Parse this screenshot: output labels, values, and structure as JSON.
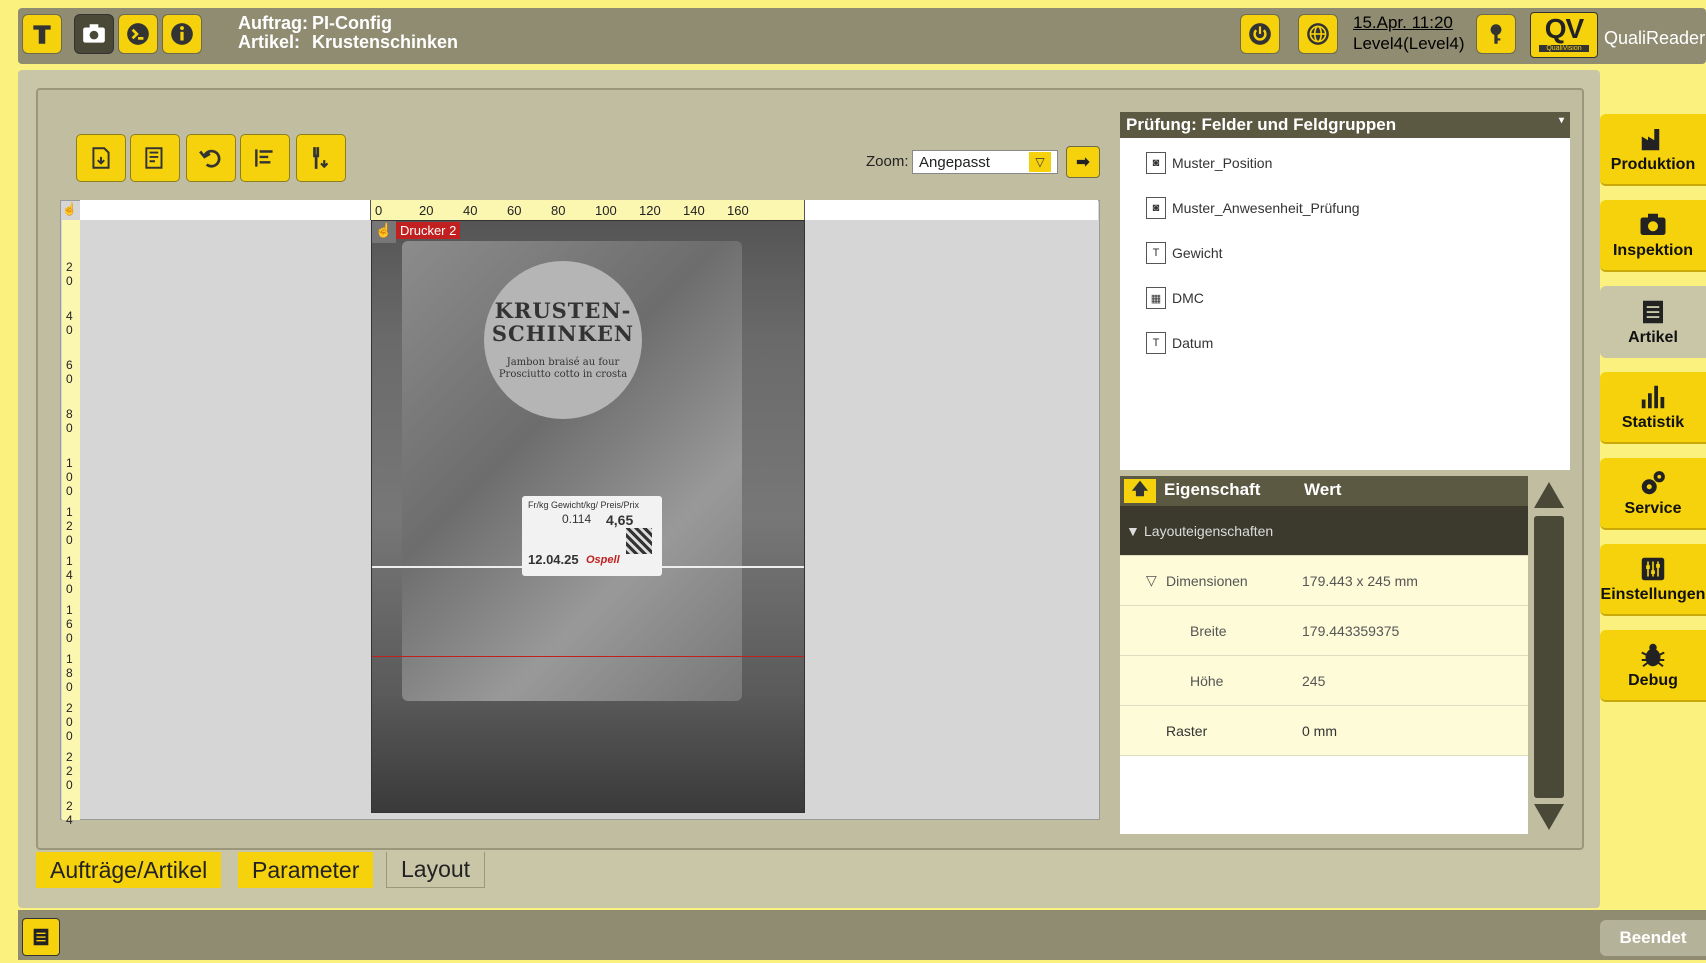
{
  "header": {
    "auftrag_label": "Auftrag:",
    "auftrag_value": "PI-Config",
    "artikel_label": "Artikel:",
    "artikel_value": "Krustenschinken",
    "datetime": "15.Apr. 11:20",
    "level": "Level4(Level4)",
    "logo_text": "QV",
    "logo_sub": "QualiVision",
    "brand": "QualiReader"
  },
  "toolbar": {
    "zoom_label": "Zoom:",
    "zoom_value": "Angepasst"
  },
  "ruler": {
    "h_ticks": [
      "0",
      "20",
      "40",
      "60",
      "80",
      "100",
      "120",
      "140",
      "160"
    ],
    "v_ticks": [
      "2 0",
      "4 0",
      "6 0",
      "8 0",
      "1 0 0",
      "1 2 0",
      "1 4 0",
      "1 6 0",
      "1 8 0",
      "2 0 0",
      "2 2 0",
      "2 4"
    ]
  },
  "image": {
    "printer_label": "Drucker 2",
    "round_label_title": "KRUSTEN-SCHINKEN",
    "round_label_sub": "Jambon braisé au four Prosciutto cotto in crosta",
    "price_header": "Fr/kg   Gewicht/kg/   Preis/Prix",
    "price": "4,65",
    "weight": "0.114",
    "date": "12.04.25",
    "brand": "Ospell"
  },
  "fields": {
    "title": "Prüfung: Felder und Feldgruppen",
    "items": [
      {
        "label": "Muster_Position",
        "icon": "pattern-icon"
      },
      {
        "label": "Muster_Anwesenheit_Prüfung",
        "icon": "pattern-icon"
      },
      {
        "label": "Gewicht",
        "icon": "ocr-icon"
      },
      {
        "label": "DMC",
        "icon": "datamatrix-icon"
      },
      {
        "label": "Datum",
        "icon": "ocr-icon"
      }
    ]
  },
  "properties": {
    "col_name": "Eigenschaft",
    "col_value": "Wert",
    "group": "Layouteigenschaften",
    "rows": [
      {
        "name": "Dimensionen",
        "value": "179.443 x 245 mm"
      },
      {
        "name": "Breite",
        "value": "179.443359375"
      },
      {
        "name": "Höhe",
        "value": "245"
      },
      {
        "name": "Raster",
        "value": "0 mm"
      }
    ]
  },
  "tabs": [
    "Aufträge/Artikel",
    "Parameter",
    "Layout"
  ],
  "sidebar": [
    "Produktion",
    "Inspektion",
    "Artikel",
    "Statistik",
    "Service",
    "Einstellungen",
    "Debug"
  ],
  "footer": {
    "exit_label": "Beendet"
  },
  "colors": {
    "accent": "#f5d20c",
    "header": "#8f8c72",
    "panel": "#c9c6a8",
    "dark": "#5b5942"
  }
}
